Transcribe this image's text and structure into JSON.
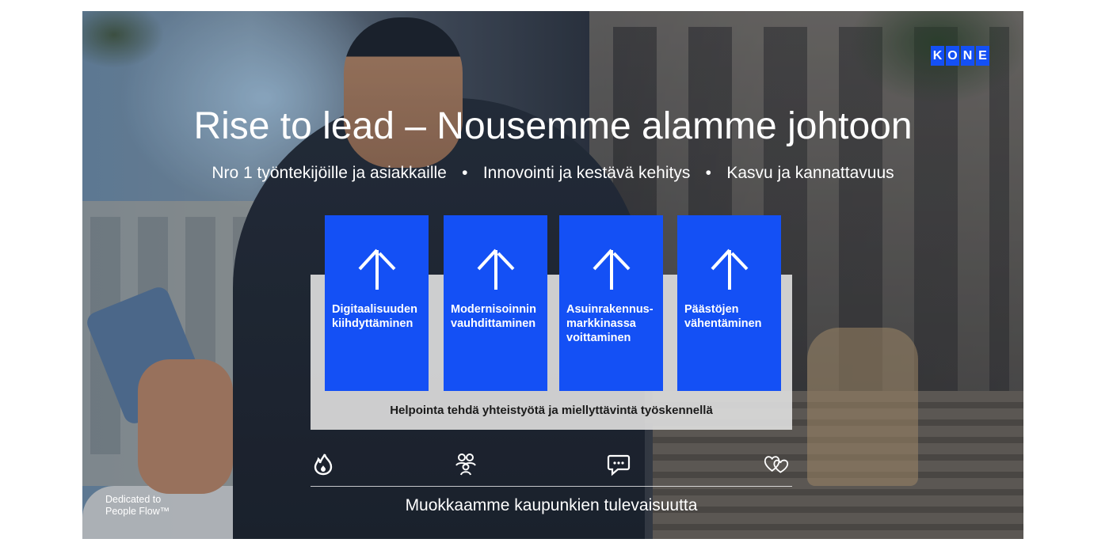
{
  "brand": {
    "logo_letters": [
      "K",
      "O",
      "N",
      "E"
    ],
    "accent_color": "#1450f5"
  },
  "title": "Rise to lead – Nousemme alamme johtoon",
  "pillars": [
    "Nro 1 työntekijöille ja asiakkaille",
    "Innovointi ja kestävä kehitys",
    "Kasvu ja kannattavuus"
  ],
  "bullet": "•",
  "priorities": [
    {
      "label": "Digitaalisuuden\nkiihdyttäminen",
      "icon": "arrow-up-icon"
    },
    {
      "label": "Modernisoinnin\nvauhdittaminen",
      "icon": "arrow-up-icon"
    },
    {
      "label": "Asuinrakennus-\nmarkkinassa\nvoittaminen",
      "icon": "arrow-up-icon"
    },
    {
      "label": "Päästöjen\nvähentäminen",
      "icon": "arrow-up-icon"
    }
  ],
  "foundation": "Helpointa tehdä yhteistyötä ja miellyttävintä työskennellä",
  "values_icons": [
    "flame-icon",
    "people-icon",
    "chat-icon",
    "hearts-icon"
  ],
  "tagline": "Muokkaamme kaupunkien tulevaisuutta",
  "dedicated": "Dedicated to\nPeople Flow™"
}
